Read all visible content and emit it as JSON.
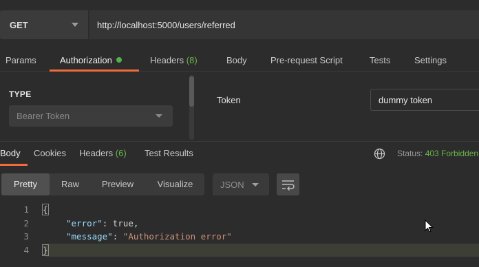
{
  "request": {
    "method": "GET",
    "url": "http://localhost:5000/users/referred"
  },
  "request_tabs": [
    {
      "label": "Params",
      "count": ""
    },
    {
      "label": "Authorization",
      "count": ""
    },
    {
      "label": "Headers",
      "count": "(8)"
    },
    {
      "label": "Body",
      "count": ""
    },
    {
      "label": "Pre-request Script",
      "count": ""
    },
    {
      "label": "Tests",
      "count": ""
    },
    {
      "label": "Settings",
      "count": ""
    }
  ],
  "auth": {
    "type_title": "TYPE",
    "type_value": "Bearer Token",
    "token_label": "Token",
    "token_value": "dummy token"
  },
  "response_tabs": [
    {
      "label": "Body",
      "count": ""
    },
    {
      "label": "Cookies",
      "count": ""
    },
    {
      "label": "Headers",
      "count": "(6)"
    },
    {
      "label": "Test Results",
      "count": ""
    }
  ],
  "status": {
    "label": "Status:",
    "value": "403 Forbidden"
  },
  "body_view": {
    "modes": [
      "Pretty",
      "Raw",
      "Preview",
      "Visualize"
    ],
    "format": "JSON"
  },
  "code_lines": [
    {
      "num": "1",
      "text": "{"
    },
    {
      "num": "2",
      "key": "\"error\"",
      "sep": ": ",
      "value": "true",
      "end": ","
    },
    {
      "num": "3",
      "key": "\"message\"",
      "sep": ": ",
      "value": "\"Authorization error\"",
      "end": ""
    },
    {
      "num": "4",
      "text": "}"
    }
  ],
  "colors": {
    "accent": "#f26b3a",
    "success_green": "#53b04a",
    "count_green": "#6bb449"
  },
  "icons": [
    "caret-down-icon",
    "globe-icon",
    "wrap-lines-icon",
    "mouse-cursor-icon"
  ]
}
